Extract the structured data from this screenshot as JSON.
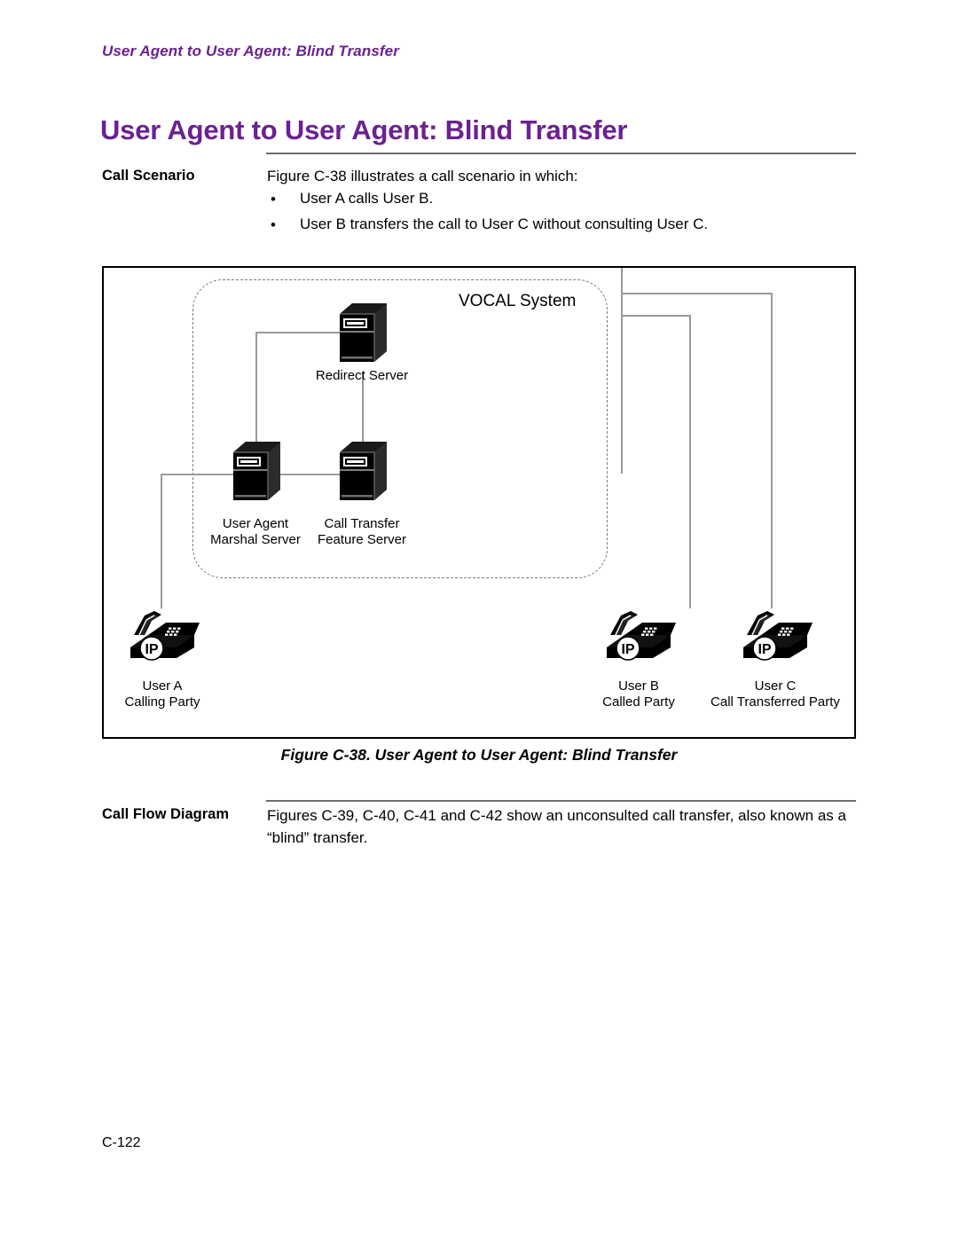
{
  "page": {
    "running_header": "User Agent to User Agent: Blind Transfer",
    "title": "User Agent to User Agent: Blind Transfer",
    "folio": "C-122",
    "accent_color": "#6B2191"
  },
  "call_scenario": {
    "label": "Call Scenario",
    "intro": "Figure C-38 illustrates a call scenario in which:",
    "bullet_glyph": "•",
    "bullets": [
      "User A calls User B.",
      "User B transfers the call to User C without consulting User C."
    ]
  },
  "figure": {
    "caption": "Figure C-38. User Agent to User Agent: Blind Transfer",
    "enclosure_label": "VOCAL System",
    "servers": [
      {
        "name": "redirect-server",
        "label_line1": "Redirect Server",
        "label_line2": ""
      },
      {
        "name": "user-agent-marshal-server",
        "label_line1": "User Agent",
        "label_line2": "Marshal Server"
      },
      {
        "name": "call-transfer-feature-server",
        "label_line1": "Call Transfer",
        "label_line2": "Feature Server"
      }
    ],
    "phones": [
      {
        "name": "user-a-phone",
        "badge": "IP",
        "label_line1": "User A",
        "label_line2": "Calling Party"
      },
      {
        "name": "user-b-phone",
        "badge": "IP",
        "label_line1": "User B",
        "label_line2": "Called Party"
      },
      {
        "name": "user-c-phone",
        "badge": "IP",
        "label_line1": "User C",
        "label_line2": "Call Transferred Party"
      }
    ]
  },
  "call_flow": {
    "label": "Call Flow Diagram",
    "text": "Figures C-39, C-40, C-41 and C-42 show an unconsulted call transfer, also known as a “blind” transfer."
  }
}
